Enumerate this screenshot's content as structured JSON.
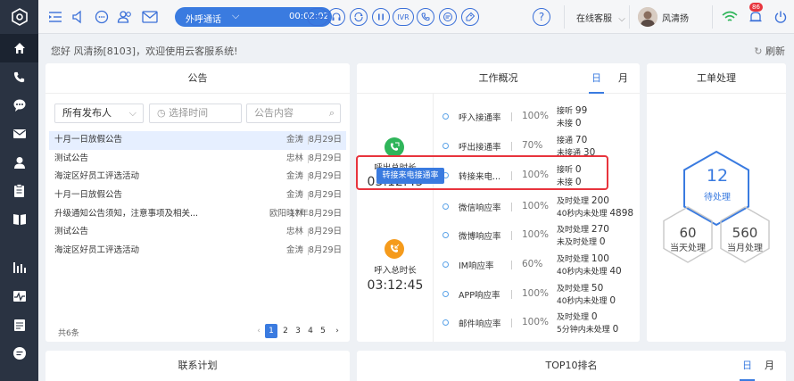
{
  "topbar": {
    "call_mode": "外呼通话",
    "call_timer": "00:02:02",
    "ivr_label": "IVR",
    "status": "在线客服",
    "user_name": "风清扬",
    "notification_count": "86"
  },
  "greeting": "您好 风清扬[8103]，欢迎使用云客服系统!",
  "refresh_label": "刷新",
  "announcements": {
    "title": "公告",
    "publisher_select": "所有发布人",
    "time_placeholder": "选择时间",
    "content_placeholder": "公告内容",
    "rows": [
      {
        "title": "十月一日放假公告",
        "author": "金涛",
        "date": "8月29日"
      },
      {
        "title": "测试公告",
        "author": "忠林",
        "date": "8月29日"
      },
      {
        "title": "海淀区好员工评选活动",
        "author": "金涛",
        "date": "8月29日"
      },
      {
        "title": "十月一日放假公告",
        "author": "金涛",
        "date": "8月29日"
      },
      {
        "title": "升级通知公告须知，注意事项及相关...",
        "author": "欧阳晓林",
        "date": "17年8月29日"
      },
      {
        "title": "测试公告",
        "author": "忠林",
        "date": "8月29日"
      },
      {
        "title": "海淀区好员工评选活动",
        "author": "金涛",
        "date": "8月29日"
      }
    ],
    "total": "共6条",
    "pages": [
      "1",
      "2",
      "3",
      "4",
      "5"
    ]
  },
  "work_overview": {
    "title": "工作概况",
    "tab_day": "日",
    "tab_month": "月",
    "call_in_label": "呼出总时长",
    "call_in_time": "03:12:45",
    "call_out_label": "呼入总时长",
    "call_out_time": "03:12:45",
    "tooltip": "转接来电接通率",
    "metrics": [
      {
        "name": "呼入接通率",
        "pct": "100%",
        "l1": "接听",
        "v1": "99",
        "l2": "未接",
        "v2": "0"
      },
      {
        "name": "呼出接通率",
        "pct": "70%",
        "l1": "接通",
        "v1": "70",
        "l2": "未接通",
        "v2": "30"
      },
      {
        "name": "转接来电...",
        "pct": "100%",
        "l1": "接听",
        "v1": "0",
        "l2": "未接",
        "v2": "0"
      },
      {
        "name": "微信响应率",
        "pct": "100%",
        "l1": "及时处理",
        "v1": "200",
        "l2": "40秒内未处理",
        "v2": "4898"
      },
      {
        "name": "微博响应率",
        "pct": "100%",
        "l1": "及时处理",
        "v1": "270",
        "l2": "未及时处理",
        "v2": "0"
      },
      {
        "name": "IM响应率",
        "pct": "60%",
        "l1": "及时处理",
        "v1": "100",
        "l2": "40秒内未处理",
        "v2": "40"
      },
      {
        "name": "APP响应率",
        "pct": "100%",
        "l1": "及时处理",
        "v1": "50",
        "l2": "40秒内未处理",
        "v2": "0"
      },
      {
        "name": "邮件响应率",
        "pct": "100%",
        "l1": "及时处理",
        "v1": "0",
        "l2": "5分钟内未处理",
        "v2": "0"
      }
    ]
  },
  "tickets": {
    "title": "工单处理",
    "pending_count": "12",
    "pending_label": "待处理",
    "today_count": "60",
    "today_label": "当天处理",
    "month_count": "560",
    "month_label": "当月处理"
  },
  "contact_plan": {
    "title": "联系计划"
  },
  "top10": {
    "title": "TOP10排名",
    "tab_day": "日",
    "tab_month": "月"
  },
  "colors": {
    "accent": "#3a7be0",
    "sidebar": "#2a3342",
    "green": "#2fb55a",
    "orange": "#f59b1c",
    "alert": "#e8343d"
  }
}
